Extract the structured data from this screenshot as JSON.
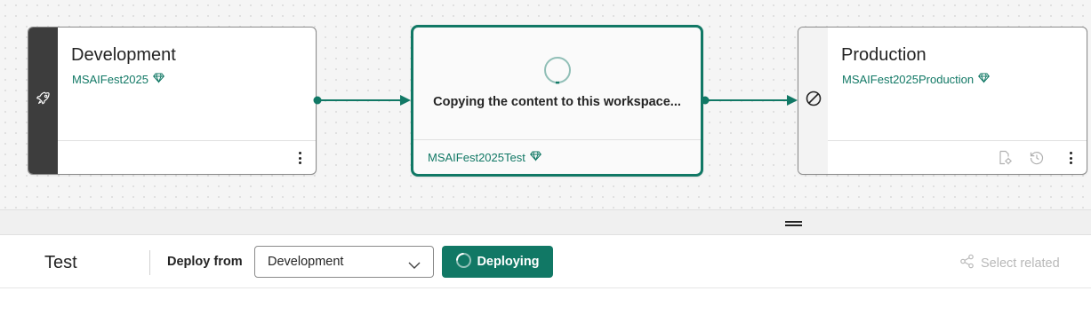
{
  "pipeline": {
    "development": {
      "title": "Development",
      "workspace": "MSAIFest2025",
      "rail_icon": "rocket-icon",
      "workspace_icon": "diamond-icon",
      "more_icon": "more-vertical-icon"
    },
    "test": {
      "status_message": "Copying the content to this workspace...",
      "workspace": "MSAIFest2025Test",
      "status_icon": "loading-spinner-icon",
      "workspace_icon": "diamond-icon"
    },
    "production": {
      "title": "Production",
      "workspace": "MSAIFest2025Production",
      "rail_icon": "blocked-icon",
      "workspace_icon": "diamond-icon",
      "footer_icons": [
        "deployment-rules-icon",
        "history-icon",
        "more-vertical-icon"
      ]
    }
  },
  "panel": {
    "resize_icon": "drag-handle-icon"
  },
  "toolbar": {
    "stage_name": "Test",
    "deploy_from_label": "Deploy from",
    "deploy_from_value": "Development",
    "deploy_button_label": "Deploying",
    "select_related_label": "Select related"
  },
  "colors": {
    "accent": "#117865",
    "stage_rail_dark": "#3d3d3d",
    "disabled_text": "#b8b8b8",
    "canvas_background": "#f5f5f5"
  }
}
